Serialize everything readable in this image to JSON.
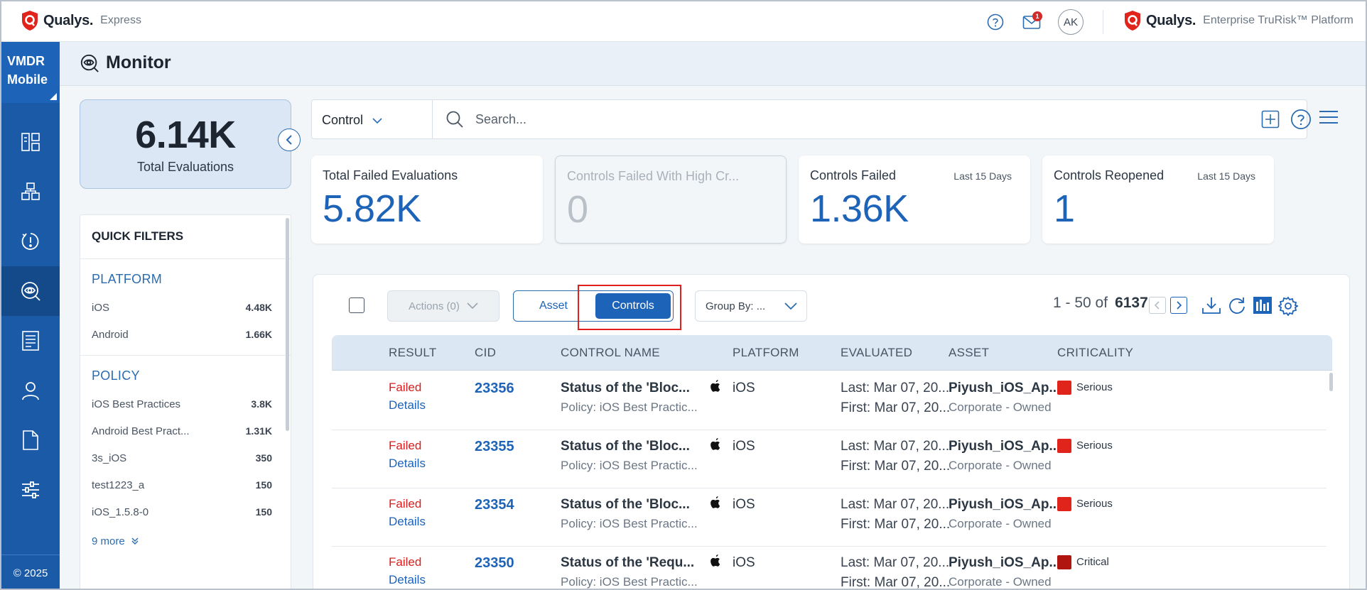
{
  "topbar": {
    "brand": "Qualys.",
    "product": "Express",
    "brand_right": "Qualys.",
    "product_right": "Enterprise TruRisk™ Platform",
    "notification_count": "1",
    "avatar_initials": "AK"
  },
  "sidebar": {
    "module_line1": "VMDR",
    "module_line2": "Mobile",
    "items": [
      {
        "icon": "dashboard-icon"
      },
      {
        "icon": "inventory-icon"
      },
      {
        "icon": "vulnerability-icon"
      },
      {
        "icon": "monitor-icon",
        "active": true
      },
      {
        "icon": "reports-icon"
      },
      {
        "icon": "users-icon"
      },
      {
        "icon": "document-icon"
      },
      {
        "icon": "settings-sliders-icon"
      }
    ],
    "copyright": "© 2025"
  },
  "page": {
    "title": "Monitor"
  },
  "summary": {
    "total_value": "6.14K",
    "total_label": "Total Evaluations"
  },
  "quick_filters": {
    "title": "QUICK FILTERS",
    "platform": {
      "title": "PLATFORM",
      "rows": [
        {
          "label": "iOS",
          "count": "4.48K"
        },
        {
          "label": "Android",
          "count": "1.66K"
        }
      ]
    },
    "policy": {
      "title": "POLICY",
      "rows": [
        {
          "label": "iOS Best Practices",
          "count": "3.8K"
        },
        {
          "label": "Android Best Pract...",
          "count": "1.31K"
        },
        {
          "label": "3s_iOS",
          "count": "350"
        },
        {
          "label": "test1223_a",
          "count": "150"
        },
        {
          "label": "iOS_1.5.8-0",
          "count": "150"
        }
      ]
    },
    "more": "9 more"
  },
  "search": {
    "scope": "Control",
    "placeholder": "Search..."
  },
  "stats": [
    {
      "title": "Total Failed Evaluations",
      "value": "5.82K",
      "period": ""
    },
    {
      "title": "Controls Failed With High Cr...",
      "value": "0",
      "period": ""
    },
    {
      "title": "Controls Failed",
      "value": "1.36K",
      "period": "Last 15 Days"
    },
    {
      "title": "Controls Reopened",
      "value": "1",
      "period": "Last 15 Days"
    }
  ],
  "toolbar": {
    "actions_label": "Actions (0)",
    "asset_label": "Asset",
    "controls_label": "Controls",
    "groupby_label": "Group By: ...",
    "range": "1 - 50 of",
    "total": "6137"
  },
  "table": {
    "headers": [
      "RESULT",
      "CID",
      "CONTROL NAME",
      "PLATFORM",
      "EVALUATED",
      "ASSET",
      "CRITICALITY"
    ],
    "rows": [
      {
        "result": "Failed",
        "details": "Details",
        "cid": "23356",
        "name": "Status of the 'Bloc...",
        "policy": "Policy: iOS Best Practic...",
        "platform": "iOS",
        "last": "Last: Mar 07, 20...",
        "first": "First: Mar 07, 20...",
        "asset": "Piyush_iOS_Ap...",
        "owner": "Corporate - Owned",
        "criticality": "Serious",
        "crit_color": "#e0241b"
      },
      {
        "result": "Failed",
        "details": "Details",
        "cid": "23355",
        "name": "Status of the 'Bloc...",
        "policy": "Policy: iOS Best Practic...",
        "platform": "iOS",
        "last": "Last: Mar 07, 20...",
        "first": "First: Mar 07, 20...",
        "asset": "Piyush_iOS_Ap...",
        "owner": "Corporate - Owned",
        "criticality": "Serious",
        "crit_color": "#e0241b"
      },
      {
        "result": "Failed",
        "details": "Details",
        "cid": "23354",
        "name": "Status of the 'Bloc...",
        "policy": "Policy: iOS Best Practic...",
        "platform": "iOS",
        "last": "Last: Mar 07, 20...",
        "first": "First: Mar 07, 20...",
        "asset": "Piyush_iOS_Ap...",
        "owner": "Corporate - Owned",
        "criticality": "Serious",
        "crit_color": "#e0241b"
      },
      {
        "result": "Failed",
        "details": "Details",
        "cid": "23350",
        "name": "Status of the 'Requ...",
        "policy": "Policy: iOS Best Practic...",
        "platform": "iOS",
        "last": "Last: Mar 07, 20...",
        "first": "First: Mar 07, 20...",
        "asset": "Piyush_iOS_Ap...",
        "owner": "Corporate - Owned",
        "criticality": "Critical",
        "crit_color": "#b0150f"
      }
    ]
  },
  "colors": {
    "accent": "#1d63b8",
    "sidebar": "#1a5aa6",
    "failed": "#d81e1e"
  }
}
